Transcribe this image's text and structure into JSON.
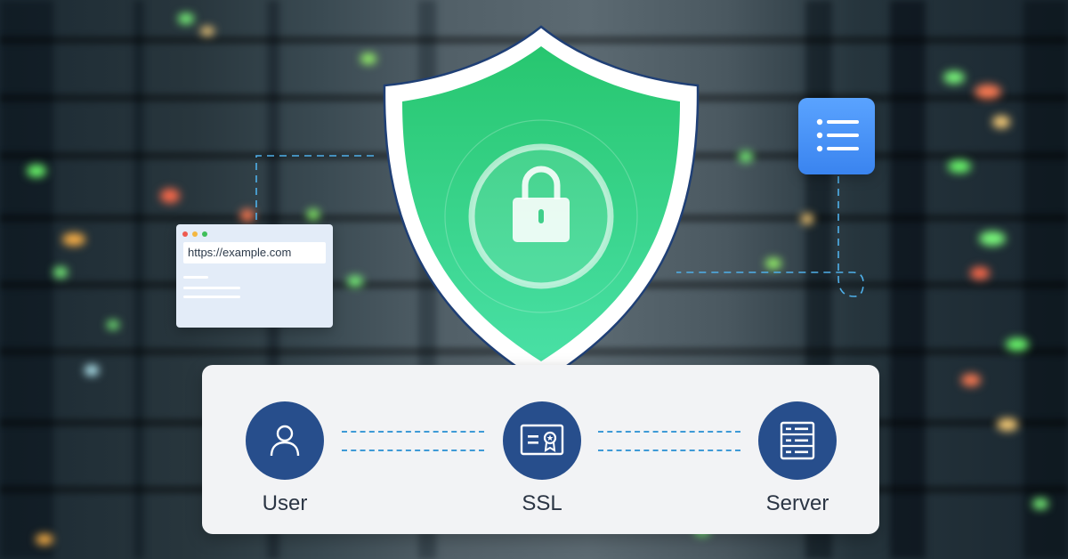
{
  "browser": {
    "url": "https://example.com",
    "dot_colors": [
      "#ee5a4f",
      "#f4b740",
      "#3fbf5a"
    ]
  },
  "shield": {
    "gradient_top": "#27c66f",
    "gradient_bottom": "#49e0a5",
    "icon": "lock-icon"
  },
  "list_card": {
    "icon": "list-icon"
  },
  "flow": {
    "nodes": [
      {
        "label": "User",
        "icon": "user-icon"
      },
      {
        "label": "SSL",
        "icon": "certificate-icon"
      },
      {
        "label": "Server",
        "icon": "server-icon"
      }
    ]
  },
  "colors": {
    "node_fill": "#274e8c",
    "dash": "#3e9ad6",
    "panel": "#f2f3f5",
    "list_card": "#4b95f7"
  }
}
